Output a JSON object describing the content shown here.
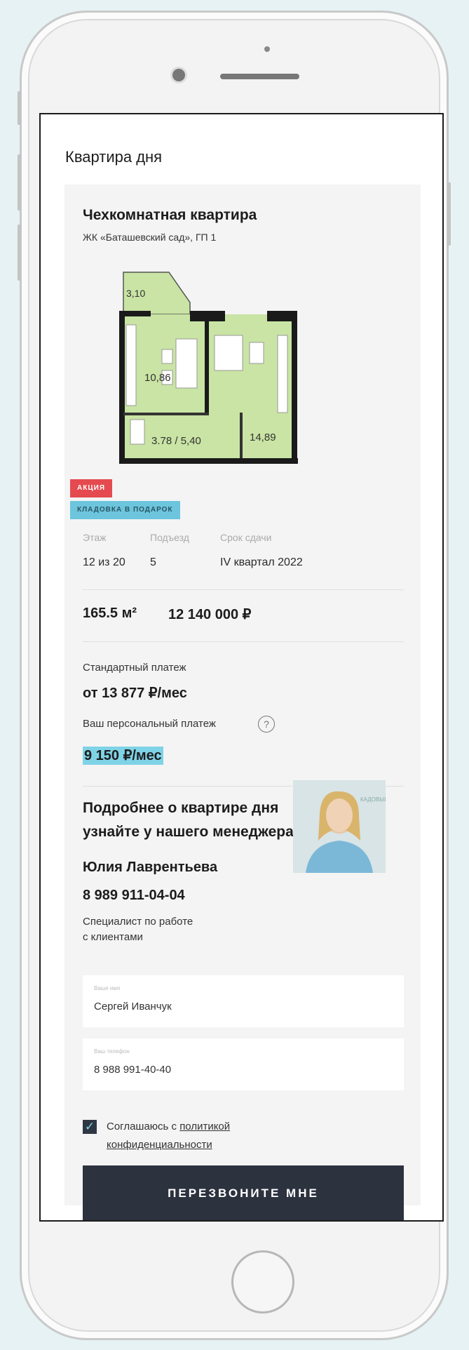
{
  "section_title": "Квартира дня",
  "apartment": {
    "title": "Чехкомнатная квартира",
    "complex": "ЖК «Баташевский сад», ГП 1",
    "plan_labels": {
      "balcony": "3,10",
      "kitchen": "10,86",
      "bath": "3.78 / 5,40",
      "room": "14,89"
    },
    "badges": {
      "sale": "АКЦИЯ",
      "storage": "КЛАДОВКА В ПОДАРОК"
    },
    "info": {
      "floor_label": "Этаж",
      "floor_value": "12 из 20",
      "entrance_label": "Подъезд",
      "entrance_value": "5",
      "deadline_label": "Срок сдачи",
      "deadline_value": "IV квартал 2022"
    },
    "area": "165.5 м²",
    "price": "12 140 000 ₽"
  },
  "payments": {
    "standard_label": "Стандартный платеж",
    "standard_value": "от 13 877 ₽/мес",
    "personal_label": "Ваш персональный платеж",
    "help_icon": "?",
    "personal_value": "9 150 ₽/мес"
  },
  "manager": {
    "cta_line1": "Подробнее о квартире дня",
    "cta_line2": "узнайте у нашего менеджера",
    "name": "Юлия Лаврентьева",
    "phone": "8 989 911-04-04",
    "role_line1": "Специалист по работе",
    "role_line2": "с клиентами",
    "photo_sign": "КАДОВЫЙ"
  },
  "form": {
    "name_label": "Ваше имя",
    "name_value": "Сергей Иванчук",
    "phone_label": "Ваш телефон",
    "phone_value": "8 988 991-40-40",
    "consent_text": "Соглашаюсь с ",
    "consent_link1": "политикой",
    "consent_link2": "конфиденциальности",
    "submit_label": "ПЕРЕЗВОНИТЕ МНЕ"
  },
  "colors": {
    "accent": "#7fd3e6",
    "sale": "#e44a4f",
    "button": "#2c323e",
    "plan_fill": "#c9e4a4"
  }
}
